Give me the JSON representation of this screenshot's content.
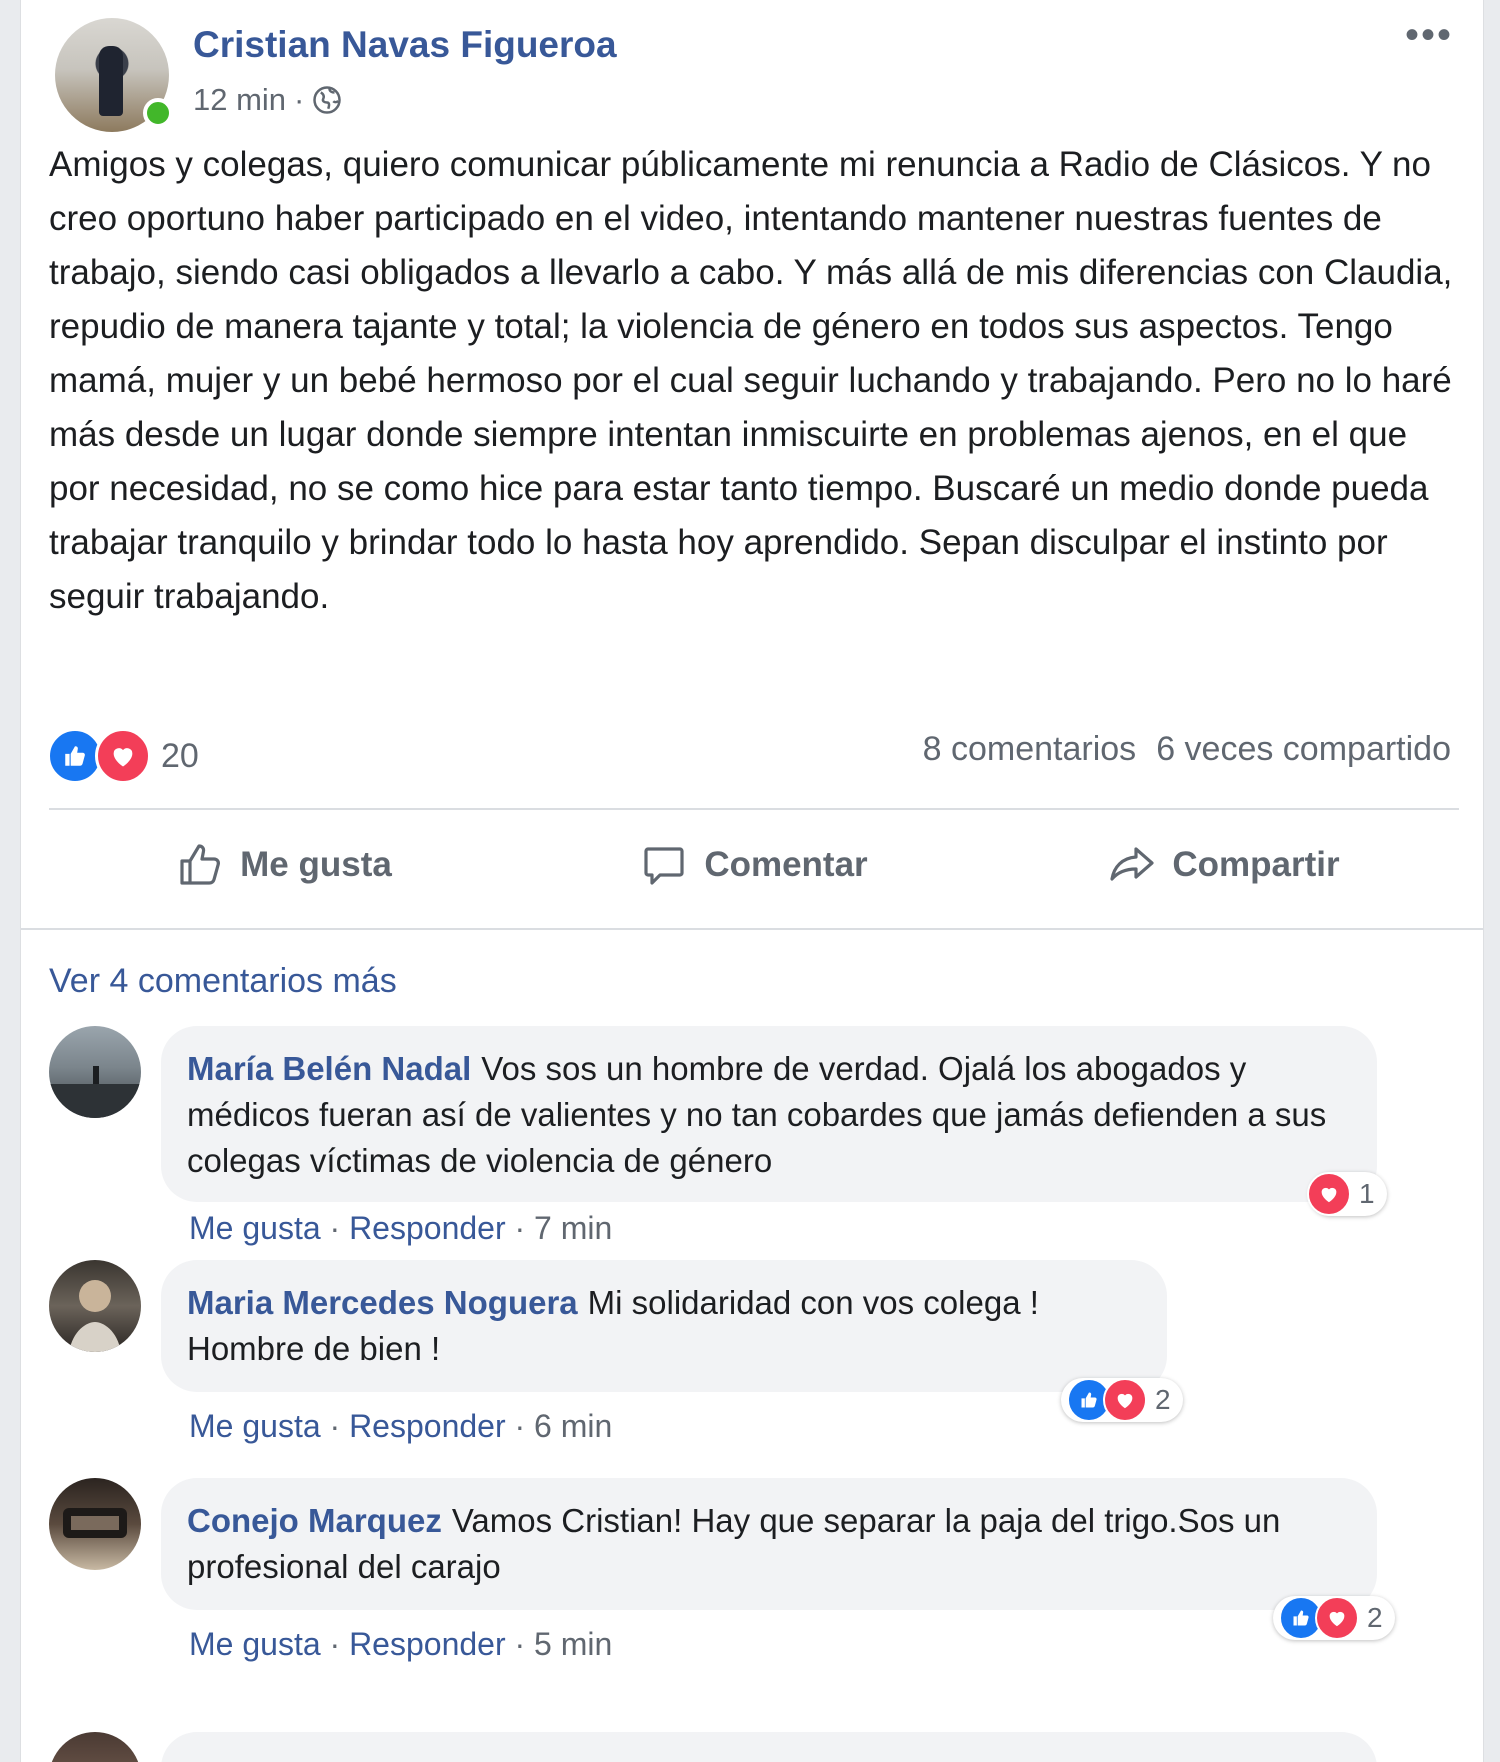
{
  "post": {
    "author": "Cristian Navas Figueroa",
    "time": "12 min",
    "separator": "·",
    "more": "•••",
    "text": "Amigos y colegas, quiero comunicar públicamente mi renuncia a Radio de Clásicos. Y no creo oportuno haber participado en el video, intentando mantener nuestras fuentes de trabajo, siendo casi obligados a llevarlo a cabo. Y más allá de mis diferencias con Claudia, repudio de manera tajante y total; la violencia de género en todos sus aspectos. Tengo mamá, mujer y un bebé hermoso por el cual seguir luchando y trabajando. Pero no lo haré más desde un lugar donde siempre intentan inmiscuirte en problemas ajenos, en el que por necesidad, no se como hice para estar tanto tiempo. Buscaré un medio donde pueda trabajar tranquilo y brindar todo lo hasta hoy aprendido. Sepan disculpar el instinto por seguir trabajando.",
    "reaction_count": "20",
    "comments_count": "8 comentarios",
    "shares_count": "6 veces compartido"
  },
  "actions": {
    "like": "Me gusta",
    "comment": "Comentar",
    "share": "Compartir"
  },
  "see_more": "Ver 4 comentarios más",
  "comment_links": {
    "like": "Me gusta",
    "reply": "Responder",
    "separator": "·"
  },
  "comments": [
    {
      "author": "María Belén Nadal",
      "text": "Vos sos un hombre de verdad. Ojalá los abogados y médicos fueran así de valientes y no tan cobardes que jamás defienden a sus colegas víctimas de violencia de género",
      "time": "7 min",
      "reaction_count": "1"
    },
    {
      "author": "Maria Mercedes Noguera",
      "text": "Mi solidaridad con vos colega ! Hombre de bien !",
      "time": "6 min",
      "reaction_count": "2"
    },
    {
      "author": "Conejo Marquez",
      "text": "Vamos Cristian! Hay que separar la paja del trigo.Sos un profesional del carajo",
      "time": "5 min",
      "reaction_count": "2"
    }
  ],
  "colors": {
    "link": "#385898",
    "secondary_text": "#606770",
    "like_blue": "#1877f2",
    "love_red": "#f33e58",
    "online_green": "#42b72a",
    "bubble_bg": "#f2f3f5"
  },
  "icons": {
    "globe": "globe-icon",
    "like": "thumbs-up-icon",
    "comment": "speech-bubble-icon",
    "share": "share-arrow-icon",
    "more": "more-dots-icon"
  }
}
